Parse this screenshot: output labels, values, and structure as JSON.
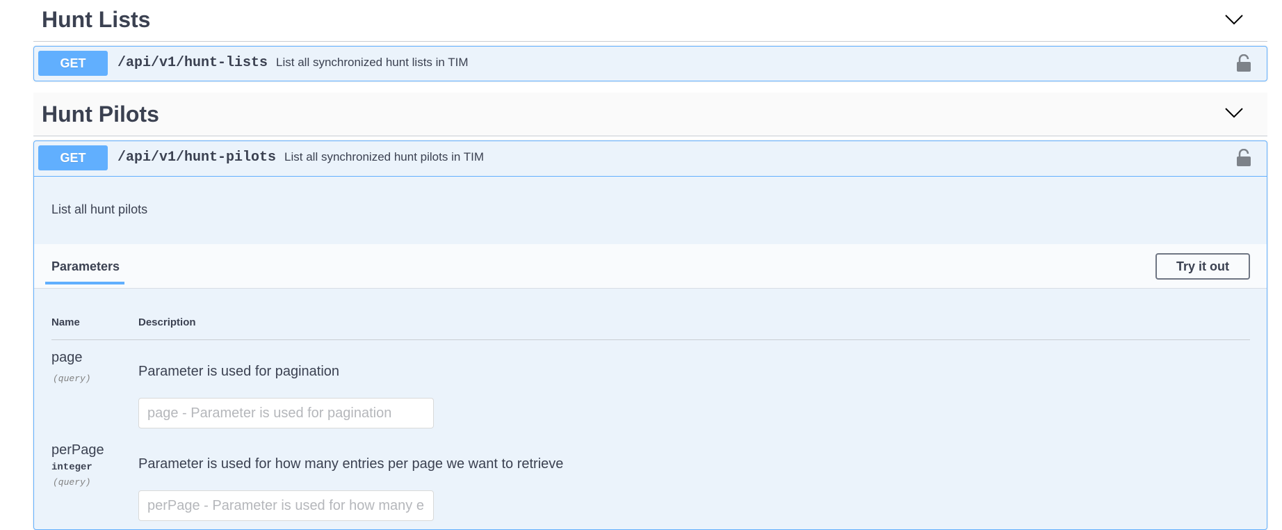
{
  "sections": [
    {
      "title": "Hunt Lists",
      "operations": [
        {
          "method": "GET",
          "path": "/api/v1/hunt-lists",
          "summary": "List all synchronized hunt lists in TIM"
        }
      ]
    },
    {
      "title": "Hunt Pilots",
      "operations": [
        {
          "method": "GET",
          "path": "/api/v1/hunt-pilots",
          "summary": "List all synchronized hunt pilots in TIM",
          "description": "List all hunt pilots",
          "parameters_tab": "Parameters",
          "try_label": "Try it out",
          "columns": {
            "name": "Name",
            "description": "Description"
          },
          "params": [
            {
              "name": "page",
              "type": "",
              "in": "(query)",
              "description": "Parameter is used for pagination",
              "placeholder": "page - Parameter is used for pagination"
            },
            {
              "name": "perPage",
              "type": "integer",
              "in": "(query)",
              "description": "Parameter is used for how many entries per page we want to retrieve",
              "placeholder": "perPage - Parameter is used for how many entries per page we want to retrieve"
            }
          ]
        }
      ]
    }
  ],
  "colors": {
    "get_method": "#61affe",
    "get_bg": "#ebf3fb",
    "text": "#3b4151"
  },
  "icons": {
    "collapse": "chevron-down-icon",
    "auth": "lock-icon"
  }
}
